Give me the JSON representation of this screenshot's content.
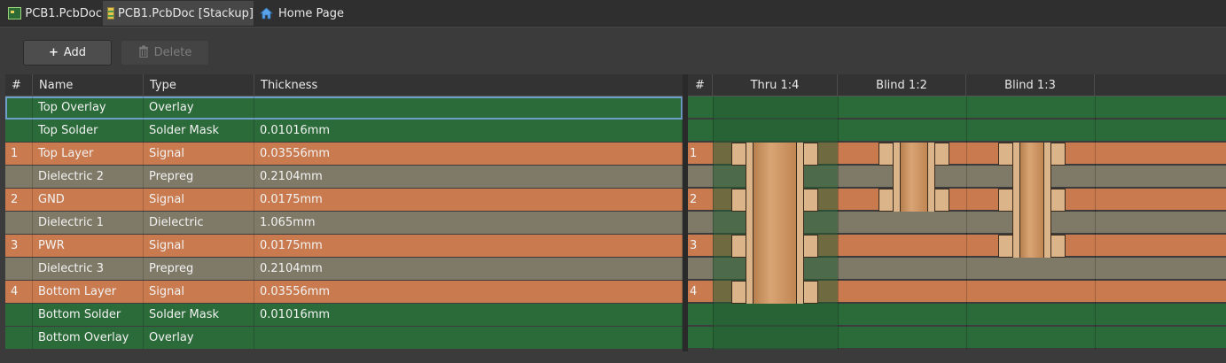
{
  "tabs": [
    {
      "label": "PCB1.PcbDoc",
      "icon": "pcb-doc-icon"
    },
    {
      "label": "PCB1.PcbDoc [Stackup]",
      "icon": "layer-stack-icon",
      "active": true
    },
    {
      "label": "Home Page",
      "icon": "home-icon"
    }
  ],
  "toolbar": {
    "add_label": "Add",
    "delete_label": "Delete"
  },
  "table": {
    "columns": [
      "#",
      "Name",
      "Type",
      "Thickness"
    ],
    "rows": [
      {
        "num": "",
        "name": "Top Overlay",
        "type": "Overlay",
        "thickness": "",
        "kind": "overlay"
      },
      {
        "num": "",
        "name": "Top Solder",
        "type": "Solder Mask",
        "thickness": "0.01016mm",
        "kind": "mask"
      },
      {
        "num": "1",
        "name": "Top Layer",
        "type": "Signal",
        "thickness": "0.03556mm",
        "kind": "signal"
      },
      {
        "num": "",
        "name": "Dielectric 2",
        "type": "Prepreg",
        "thickness": "0.2104mm",
        "kind": "dielectric"
      },
      {
        "num": "2",
        "name": "GND",
        "type": "Signal",
        "thickness": "0.0175mm",
        "kind": "signal"
      },
      {
        "num": "",
        "name": "Dielectric 1",
        "type": "Dielectric",
        "thickness": "1.065mm",
        "kind": "dielectric"
      },
      {
        "num": "3",
        "name": "PWR",
        "type": "Signal",
        "thickness": "0.0175mm",
        "kind": "signal"
      },
      {
        "num": "",
        "name": "Dielectric 3",
        "type": "Prepreg",
        "thickness": "0.2104mm",
        "kind": "dielectric"
      },
      {
        "num": "4",
        "name": "Bottom Layer",
        "type": "Signal",
        "thickness": "0.03556mm",
        "kind": "signal"
      },
      {
        "num": "",
        "name": "Bottom Solder",
        "type": "Solder Mask",
        "thickness": "0.01016mm",
        "kind": "mask"
      },
      {
        "num": "",
        "name": "Bottom Overlay",
        "type": "Overlay",
        "thickness": "",
        "kind": "overlay"
      }
    ]
  },
  "via_panel": {
    "num_header": "#",
    "spans": [
      {
        "label": "Thru 1:4",
        "from": 1,
        "to": 4
      },
      {
        "label": "Blind 1:2",
        "from": 1,
        "to": 2
      },
      {
        "label": "Blind 1:3",
        "from": 1,
        "to": 3
      }
    ]
  },
  "colors": {
    "overlay": "#2b6a39",
    "mask": "#2b6a39",
    "signal": "#c97b4f",
    "dielectric": "#7f7a68",
    "copper_barrel": "#c8935f",
    "copper_pad": "#dcb48a",
    "thru_highlight": "#255d33"
  }
}
